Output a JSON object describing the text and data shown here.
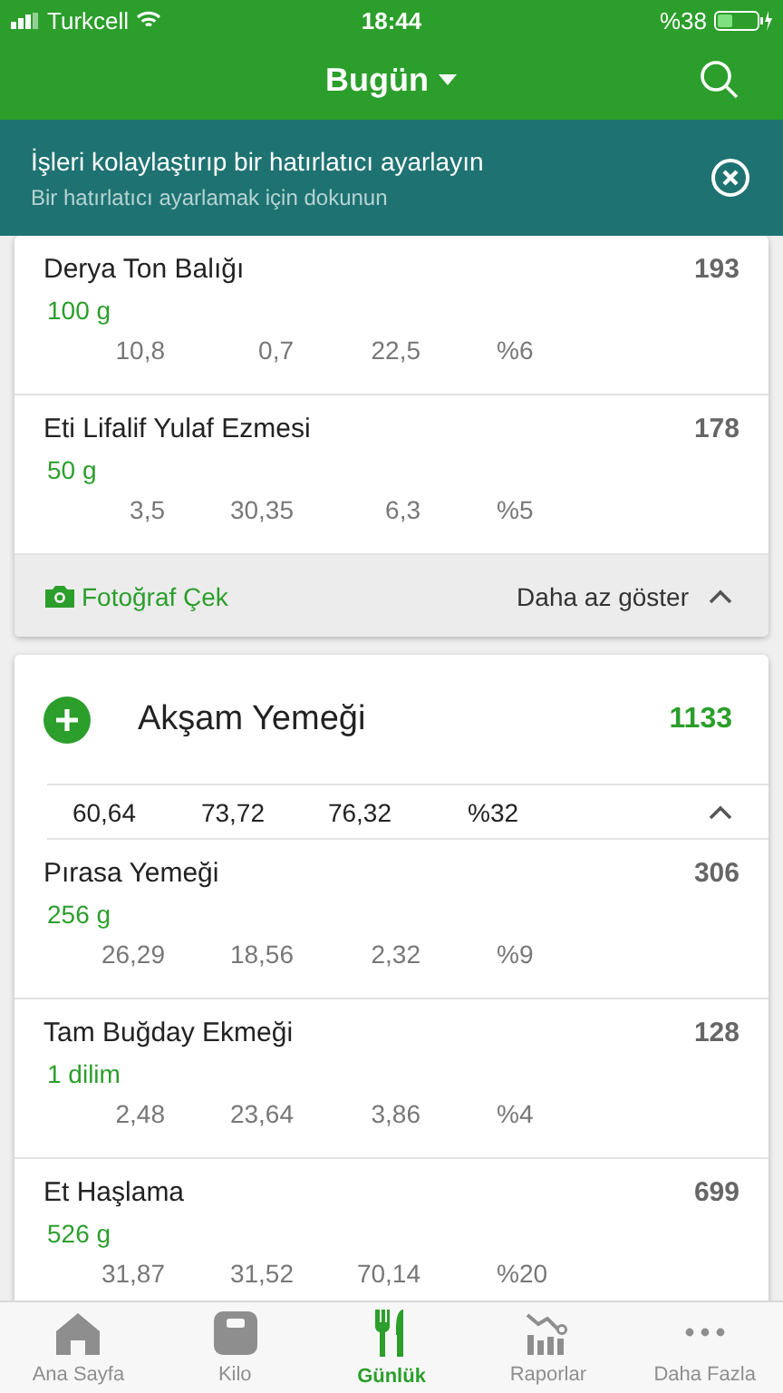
{
  "status_bar": {
    "carrier": "Turkcell",
    "time": "18:44",
    "battery": "%38"
  },
  "header": {
    "title": "Bugün"
  },
  "banner": {
    "title": "İşleri kolaylaştırıp bir hatırlatıcı ayarlayın",
    "subtitle": "Bir hatırlatıcı ayarlamak için dokunun"
  },
  "cards": [
    {
      "kind": "partial",
      "items": [
        {
          "name": "Derya Ton Balığı",
          "calories": "193",
          "amount": "100 g",
          "values": [
            "10,8",
            "0,7",
            "22,5",
            "%6"
          ]
        },
        {
          "name": "Eti Lifalif Yulaf Ezmesi",
          "calories": "178",
          "amount": "50 g",
          "values": [
            "3,5",
            "30,35",
            "6,3",
            "%5"
          ]
        }
      ],
      "footer": {
        "photo_label": "Fotoğraf Çek",
        "toggle_label": "Daha az göster"
      }
    },
    {
      "kind": "meal",
      "title": "Akşam Yemeği",
      "calories": "1133",
      "summary": [
        "60,64",
        "73,72",
        "76,32",
        "%32"
      ],
      "expanded": true,
      "items": [
        {
          "name": "Pırasa Yemeği",
          "calories": "306",
          "amount": "256 g",
          "values": [
            "26,29",
            "18,56",
            "2,32",
            "%9"
          ]
        },
        {
          "name": "Tam Buğday Ekmeği",
          "calories": "128",
          "amount": "1 dilim",
          "values": [
            "2,48",
            "23,64",
            "3,86",
            "%4"
          ]
        },
        {
          "name": "Et Haşlama",
          "calories": "699",
          "amount": "526 g",
          "values": [
            "31,87",
            "31,52",
            "70,14",
            "%20"
          ]
        }
      ]
    }
  ],
  "tab_bar": [
    {
      "kind": "home",
      "label": "Ana Sayfa",
      "selected": false
    },
    {
      "kind": "scale",
      "label": "Kilo",
      "selected": false
    },
    {
      "kind": "diary",
      "label": "Günlük",
      "selected": true
    },
    {
      "kind": "reports",
      "label": "Raporlar",
      "selected": false
    },
    {
      "kind": "more",
      "label": "Daha Fazla",
      "selected": false
    }
  ]
}
